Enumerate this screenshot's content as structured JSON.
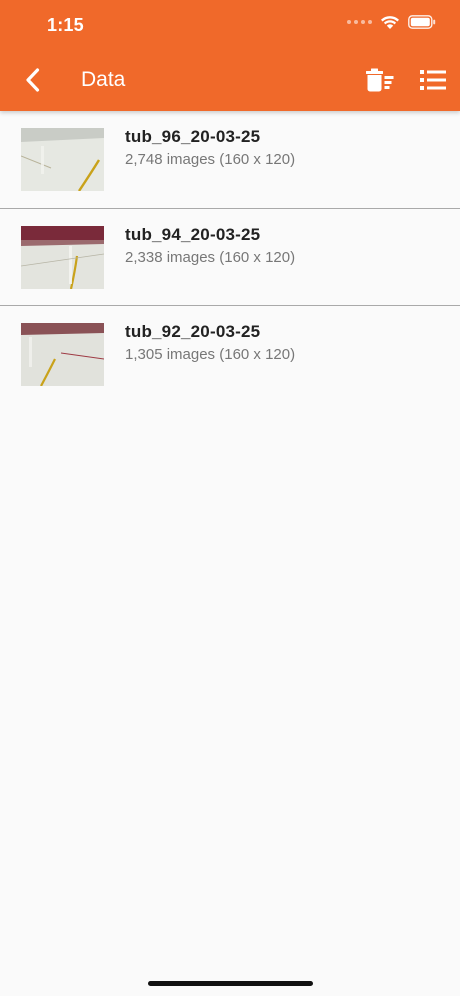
{
  "status_bar": {
    "time": "1:15"
  },
  "app_bar": {
    "title": "Data",
    "back_icon": "chevron-left-icon",
    "delete_icon": "delete-sweep-icon",
    "list_icon": "list-icon",
    "color": "#f0692a"
  },
  "tubs": [
    {
      "name": "tub_96_20-03-25",
      "details": "2,748 images (160 x 120)"
    },
    {
      "name": "tub_94_20-03-25",
      "details": "2,338 images (160 x 120)"
    },
    {
      "name": "tub_92_20-03-25",
      "details": "1,305 images (160 x 120)"
    }
  ]
}
